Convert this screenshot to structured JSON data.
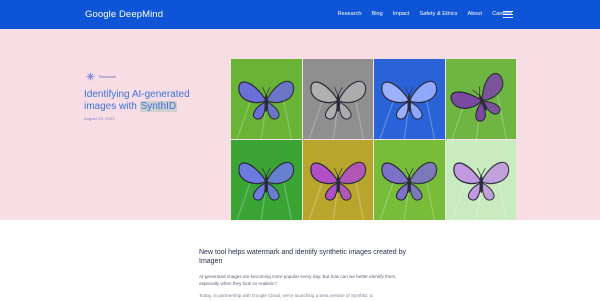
{
  "nav": {
    "logo": "Google DeepMind",
    "items": [
      "Research",
      "Blog",
      "Impact",
      "Safety & Ethics",
      "About",
      "Careers"
    ]
  },
  "hero": {
    "badge": "Research",
    "title_part1": "Identifying AI-generated images with ",
    "title_highlight": "SynthID",
    "date": "August 29, 2023",
    "bg_color": "#f9dde4",
    "accent_color": "#3b73d9"
  },
  "grid": {
    "tiles": [
      {
        "bg": "#69b336",
        "wing": "#6b6fd8"
      },
      {
        "bg": "#8f8f8f",
        "wing": "#b0b0b0"
      },
      {
        "bg": "#2a63d8",
        "wing": "#9bb0ff"
      },
      {
        "bg": "#6fb542",
        "wing": "#7b4aa0"
      },
      {
        "bg": "#3aa435",
        "wing": "#6b7be0"
      },
      {
        "bg": "#b8a62c",
        "wing": "#b24fc8"
      },
      {
        "bg": "#77bd3a",
        "wing": "#7d71c8"
      },
      {
        "bg": "#c8ebbf",
        "wing": "#c199e0"
      }
    ]
  },
  "article": {
    "heading": "New tool helps watermark and identify synthetic images created by Imagen",
    "p1": "AI-generated images are becoming more popular every day. But how can we better identify them, especially when they look so realistic?",
    "p2": "Today, in partnership with Google Cloud, we're launching a beta version of SynthID, a"
  }
}
